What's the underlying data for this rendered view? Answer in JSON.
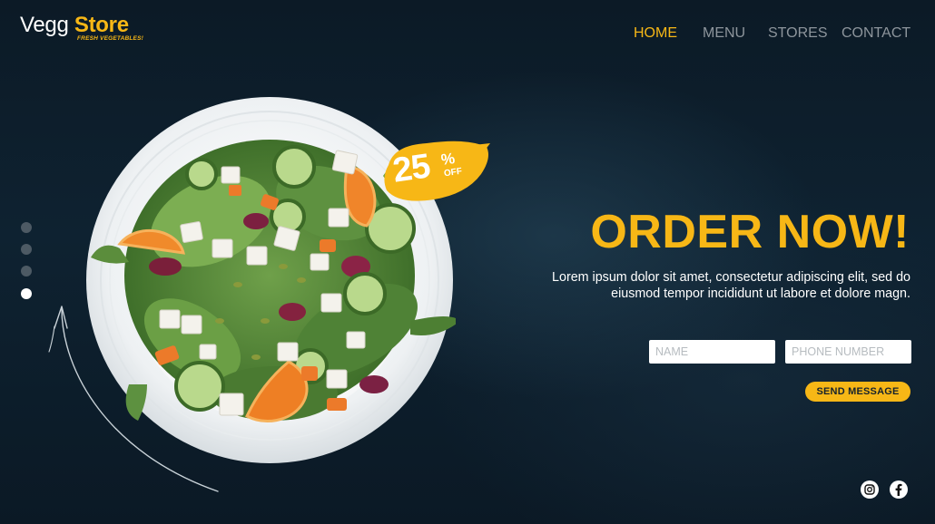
{
  "brand": {
    "name_part1": "Vegg",
    "name_part2": "Store",
    "tagline": "FRESH VEGETABLES!",
    "accent_color": "#f7b716"
  },
  "nav": {
    "items": [
      {
        "label": "HOME",
        "active": true
      },
      {
        "label": "MENU",
        "active": false
      },
      {
        "label": "STORES",
        "active": false
      },
      {
        "label": "CONTACT",
        "active": false
      }
    ]
  },
  "slider": {
    "dot_count": 4,
    "active_index": 3
  },
  "promo_badge": {
    "value": "25",
    "percent": "%",
    "off": "OFF"
  },
  "hero": {
    "title": "ORDER NOW!",
    "body": "Lorem ipsum dolor sit amet, consectetur adipiscing elit, sed do eiusmod tempor incididunt ut labore et dolore magn."
  },
  "form": {
    "name_placeholder": "NAME",
    "phone_placeholder": "PHONE NUMBER",
    "submit_label": "SEND MESSAGE"
  },
  "social": [
    {
      "icon": "instagram-icon"
    },
    {
      "icon": "facebook-icon"
    }
  ]
}
